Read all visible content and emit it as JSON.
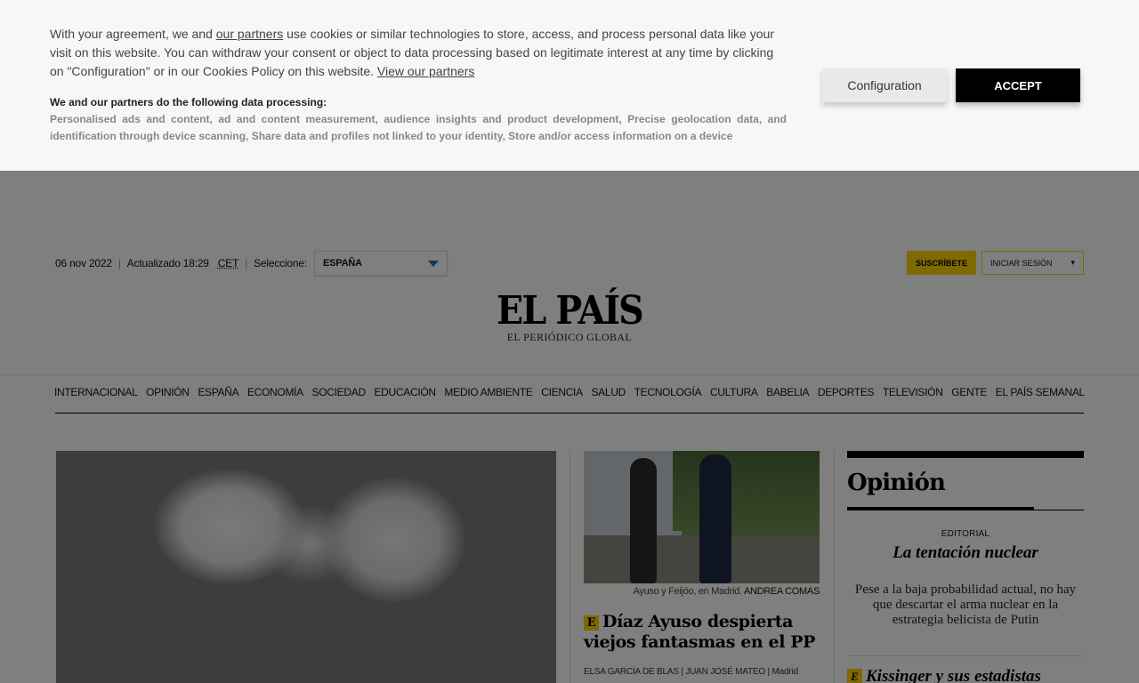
{
  "consent": {
    "text_1": "With your agreement, we and ",
    "partners_link": "our partners",
    "text_2": " use cookies or similar technologies to store, access, and process personal data like your visit on this website. You can withdraw your consent or object to data processing based on legitimate interest at any time by clicking on \"Configuration\" or in our Cookies Policy on this website. ",
    "view_partners_link": "View our partners",
    "subheading": "We and our partners do the following data processing:",
    "purposes": "Personalised ads and content, ad and content measurement, audience insights and product development, Precise geolocation data, and identification through device scanning, Share data and profiles not linked to your identity, Store and/or access information on a device",
    "config_button": "Configuration",
    "accept_button": "ACCEPT"
  },
  "topbar": {
    "date": "06 nov 2022",
    "updated": "Actualizado 18:29",
    "timezone": "CET",
    "select_label": "Seleccione:",
    "edition": "ESPAÑA",
    "subscribe": "SUSCRÍBETE",
    "login": "INICIAR SESIÓN",
    "login_caret": "▾"
  },
  "logo": {
    "name": "EL PAÍS",
    "tagline": "EL PERIÓDICO GLOBAL"
  },
  "nav": {
    "items": [
      "INTERNACIONAL",
      "OPINIÓN",
      "ESPAÑA",
      "ECONOMÍA",
      "SOCIEDAD",
      "EDUCACIÓN",
      "MEDIO AMBIENTE",
      "CIENCIA",
      "SALUD",
      "TECNOLOGÍA",
      "CULTURA",
      "BABELIA",
      "DEPORTES",
      "TELEVISIÓN",
      "GENTE",
      "EL PAÍS SEMANAL"
    ]
  },
  "article": {
    "caption": "Ayuso y Feijóo, en Madrid.",
    "credit": "ANDREA COMAS",
    "badge": "E",
    "headline": "Díaz Ayuso despierta viejos fantasmas en el PP",
    "byline": "ELSA GARCÍA DE BLAS | JUAN JOSÉ MATEO | Madrid"
  },
  "opinion": {
    "title": "Opinión",
    "kicker": "EDITORIAL",
    "headline": "La tentación nuclear",
    "summary": "Pese a la baja probabilidad actual, no hay que descartar el arma nuclear en la estrategia belicista de Putin",
    "badge": "E",
    "headline2": "Kissinger y sus estadistas"
  },
  "colors": {
    "accent_yellow": "#ffd204",
    "overlay": "rgba(0,0,0,0.5)",
    "accept_bg": "#000000"
  }
}
